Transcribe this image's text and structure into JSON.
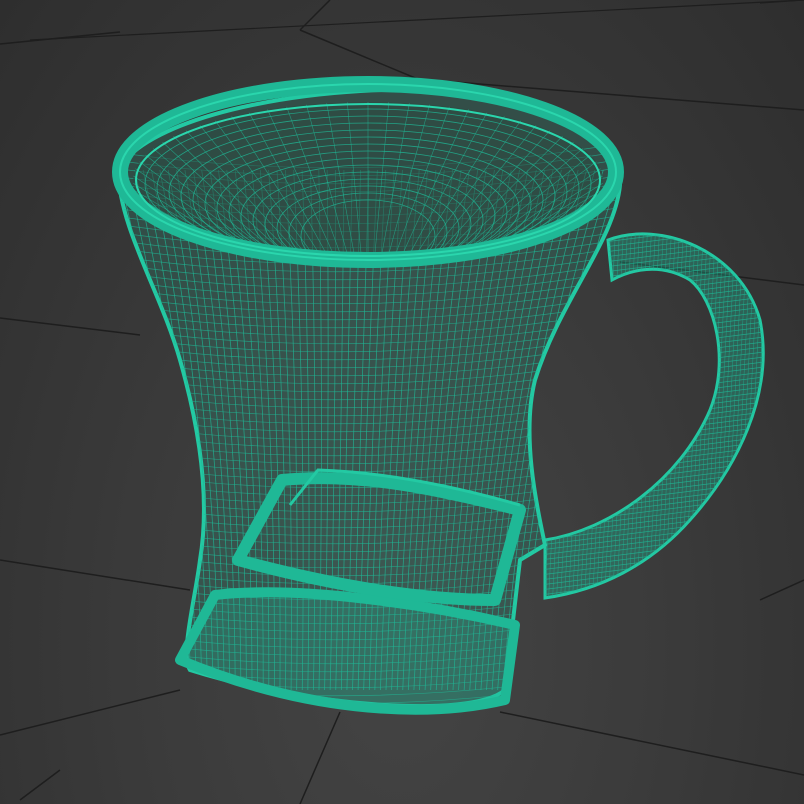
{
  "viewport": {
    "background_color": "#3a3a3a",
    "grid_color": "#1c1c1c",
    "wire_color": "#1fb896",
    "wire_dark": "#14886e",
    "view_mode": "wireframe"
  },
  "model": {
    "object_type": "mug",
    "parts": [
      "rim",
      "body",
      "handle",
      "base"
    ]
  }
}
